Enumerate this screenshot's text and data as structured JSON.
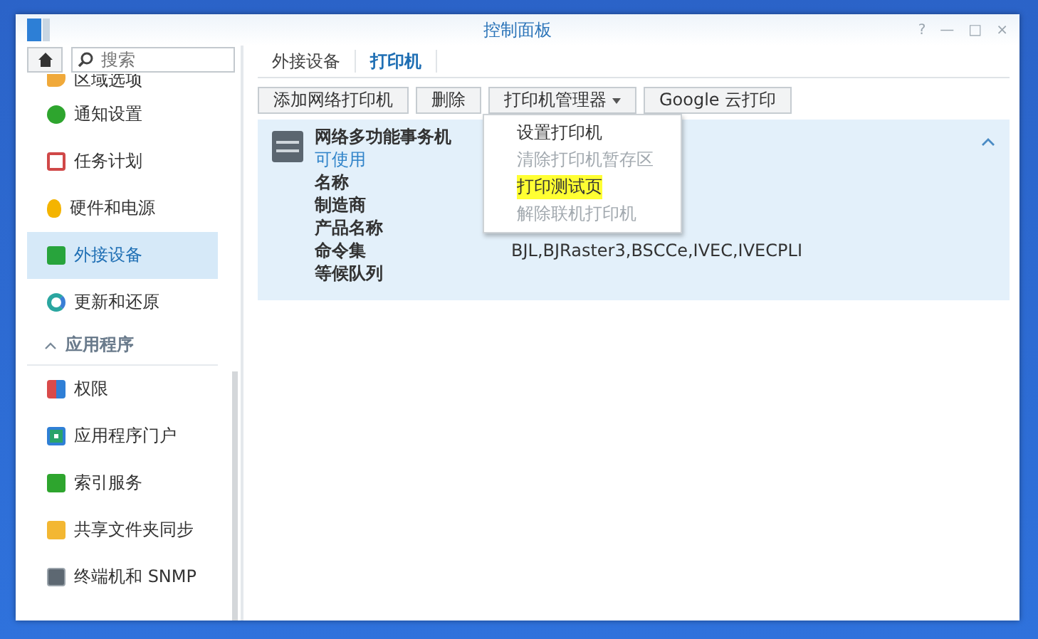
{
  "window": {
    "title": "控制面板",
    "controls": [
      "?",
      "—",
      "□",
      "×"
    ]
  },
  "search": {
    "placeholder": "搜索"
  },
  "sidebar": {
    "items": [
      {
        "label": "区域选项",
        "selected": false
      },
      {
        "label": "通知设置",
        "selected": false
      },
      {
        "label": "任务计划",
        "selected": false
      },
      {
        "label": "硬件和电源",
        "selected": false
      },
      {
        "label": "外接设备",
        "selected": true
      },
      {
        "label": "更新和还原",
        "selected": false
      }
    ],
    "section": {
      "label": "应用程序",
      "expanded": true
    },
    "app_items": [
      {
        "label": "权限",
        "selected": false
      },
      {
        "label": "应用程序门户",
        "selected": false
      },
      {
        "label": "索引服务",
        "selected": false
      },
      {
        "label": "共享文件夹同步",
        "selected": false
      },
      {
        "label": "终端机和 SNMP",
        "selected": false
      }
    ]
  },
  "tabs": [
    {
      "label": "外接设备",
      "selected": false
    },
    {
      "label": "打印机",
      "selected": true
    }
  ],
  "toolbar": [
    {
      "label": "添加网络打印机",
      "kind": "button"
    },
    {
      "label": "删除",
      "kind": "button"
    },
    {
      "label": "打印机管理器",
      "kind": "menu"
    },
    {
      "label": "Google 云打印",
      "kind": "button"
    }
  ],
  "menu": {
    "items": [
      {
        "label": "设置打印机",
        "disabled": false,
        "highlighted": false
      },
      {
        "label": "清除打印机暂存区",
        "disabled": true,
        "highlighted": false
      },
      {
        "label": "打印测试页",
        "disabled": false,
        "highlighted": true
      },
      {
        "label": "解除联机打印机",
        "disabled": true,
        "highlighted": false
      }
    ]
  },
  "printer": {
    "name": "网络多功能事务机",
    "status": "可使用",
    "expanded": true,
    "fields": [
      {
        "label": "名称"
      },
      {
        "label": "制造商"
      },
      {
        "label": "产品名称"
      },
      {
        "label": "命令集",
        "value": "BJL,BJRaster3,BSCCe,IVEC,IVECPLI"
      },
      {
        "label": "等候队列"
      }
    ]
  }
}
